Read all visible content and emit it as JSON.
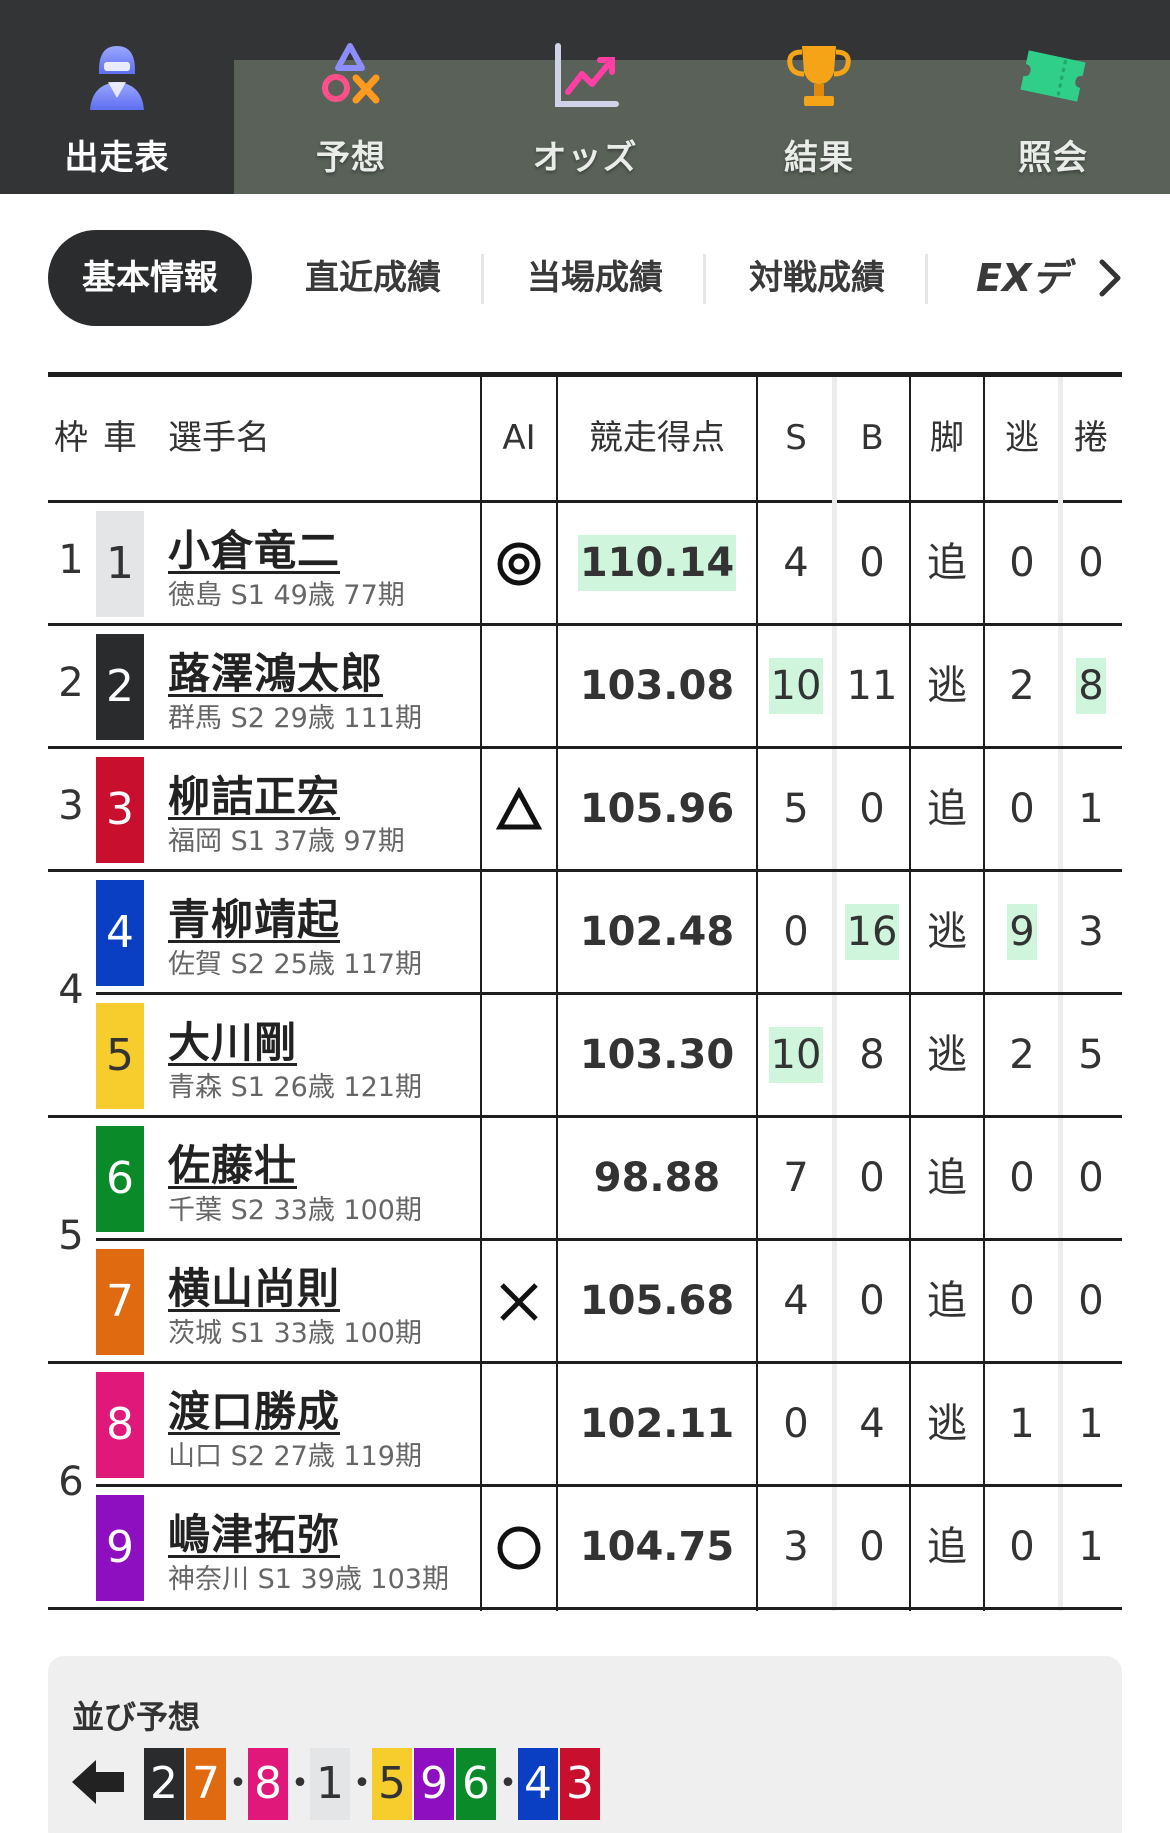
{
  "nav": {
    "items": [
      {
        "label": "出走表",
        "icon": "rider-icon",
        "active": true
      },
      {
        "label": "予想",
        "icon": "prediction-symbols-icon",
        "active": false
      },
      {
        "label": "オッズ",
        "icon": "odds-chart-icon",
        "active": false
      },
      {
        "label": "結果",
        "icon": "trophy-icon",
        "active": false
      },
      {
        "label": "照会",
        "icon": "ticket-icon",
        "active": false
      }
    ]
  },
  "subtabs": {
    "items": [
      "基本情報",
      "直近成績",
      "当場成績",
      "対戦成績"
    ],
    "active": "基本情報",
    "ex_label": "EXデ",
    "more_icon": "chevron-right-icon"
  },
  "table": {
    "headers": {
      "waku": "枠",
      "car": "車",
      "name": "選手名",
      "ai": "AI",
      "score": "競走得点",
      "s": "S",
      "b": "B",
      "kyaku": "脚",
      "nige": "逃",
      "makuri": "捲"
    },
    "waku_labels": [
      "1",
      "2",
      "3",
      "4",
      "5",
      "6"
    ],
    "rows": [
      {
        "car": "1",
        "name": "小倉竜二",
        "info": "徳島 S1 49歳 77期",
        "ai": "◎",
        "score": "110.14",
        "s": "4",
        "b": "0",
        "kyaku": "追",
        "nige": "0",
        "makuri": "0"
      },
      {
        "car": "2",
        "name": "蕗澤鴻太郎",
        "info": "群馬 S2 29歳 111期",
        "ai": "",
        "score": "103.08",
        "s": "10",
        "b": "11",
        "kyaku": "逃",
        "nige": "2",
        "makuri": "8"
      },
      {
        "car": "3",
        "name": "柳詰正宏",
        "info": "福岡 S1 37歳 97期",
        "ai": "△",
        "score": "105.96",
        "s": "5",
        "b": "0",
        "kyaku": "追",
        "nige": "0",
        "makuri": "1"
      },
      {
        "car": "4",
        "name": "青柳靖起",
        "info": "佐賀 S2 25歳 117期",
        "ai": "",
        "score": "102.48",
        "s": "0",
        "b": "16",
        "kyaku": "逃",
        "nige": "9",
        "makuri": "3"
      },
      {
        "car": "5",
        "name": "大川剛",
        "info": "青森 S1 26歳 121期",
        "ai": "",
        "score": "103.30",
        "s": "10",
        "b": "8",
        "kyaku": "逃",
        "nige": "2",
        "makuri": "5"
      },
      {
        "car": "6",
        "name": "佐藤壮",
        "info": "千葉 S2 33歳 100期",
        "ai": "",
        "score": "98.88",
        "s": "7",
        "b": "0",
        "kyaku": "追",
        "nige": "0",
        "makuri": "0"
      },
      {
        "car": "7",
        "name": "横山尚則",
        "info": "茨城 S1 33歳 100期",
        "ai": "×",
        "score": "105.68",
        "s": "4",
        "b": "0",
        "kyaku": "追",
        "nige": "0",
        "makuri": "0"
      },
      {
        "car": "8",
        "name": "渡口勝成",
        "info": "山口 S2 27歳 119期",
        "ai": "",
        "score": "102.11",
        "s": "0",
        "b": "4",
        "kyaku": "逃",
        "nige": "1",
        "makuri": "1"
      },
      {
        "car": "9",
        "name": "嶋津拓弥",
        "info": "神奈川 S1 39歳 103期",
        "ai": "○",
        "score": "104.75",
        "s": "3",
        "b": "0",
        "kyaku": "追",
        "nige": "0",
        "makuri": "1"
      }
    ],
    "highlights": {
      "score": [
        "110.14"
      ],
      "cells": [
        "r2-s",
        "r2-makuri",
        "r4-b",
        "r4-nige",
        "r5-s"
      ]
    }
  },
  "colors": {
    "car1": {
      "bg": "#e4e5e7",
      "fg": "#333333"
    },
    "car2": {
      "bg": "#2a2b2d",
      "fg": "#ffffff"
    },
    "car3": {
      "bg": "#c8102e",
      "fg": "#ffffff"
    },
    "car4": {
      "bg": "#0a3fc4",
      "fg": "#ffffff"
    },
    "car5": {
      "bg": "#f7cd2e",
      "fg": "#333333"
    },
    "car6": {
      "bg": "#0b8a2a",
      "fg": "#ffffff"
    },
    "car7": {
      "bg": "#e06a10",
      "fg": "#ffffff"
    },
    "car8": {
      "bg": "#e0187a",
      "fg": "#ffffff"
    },
    "car9": {
      "bg": "#8e0fc0",
      "fg": "#ffffff"
    },
    "highlight": "#cff5dc"
  },
  "narabi": {
    "title": "並び予想",
    "arrow_icon": "arrow-left-icon",
    "lines": [
      [
        "2",
        "7"
      ],
      [
        "8"
      ],
      [
        "1"
      ],
      [
        "5",
        "9",
        "6"
      ],
      [
        "4",
        "3"
      ]
    ]
  }
}
